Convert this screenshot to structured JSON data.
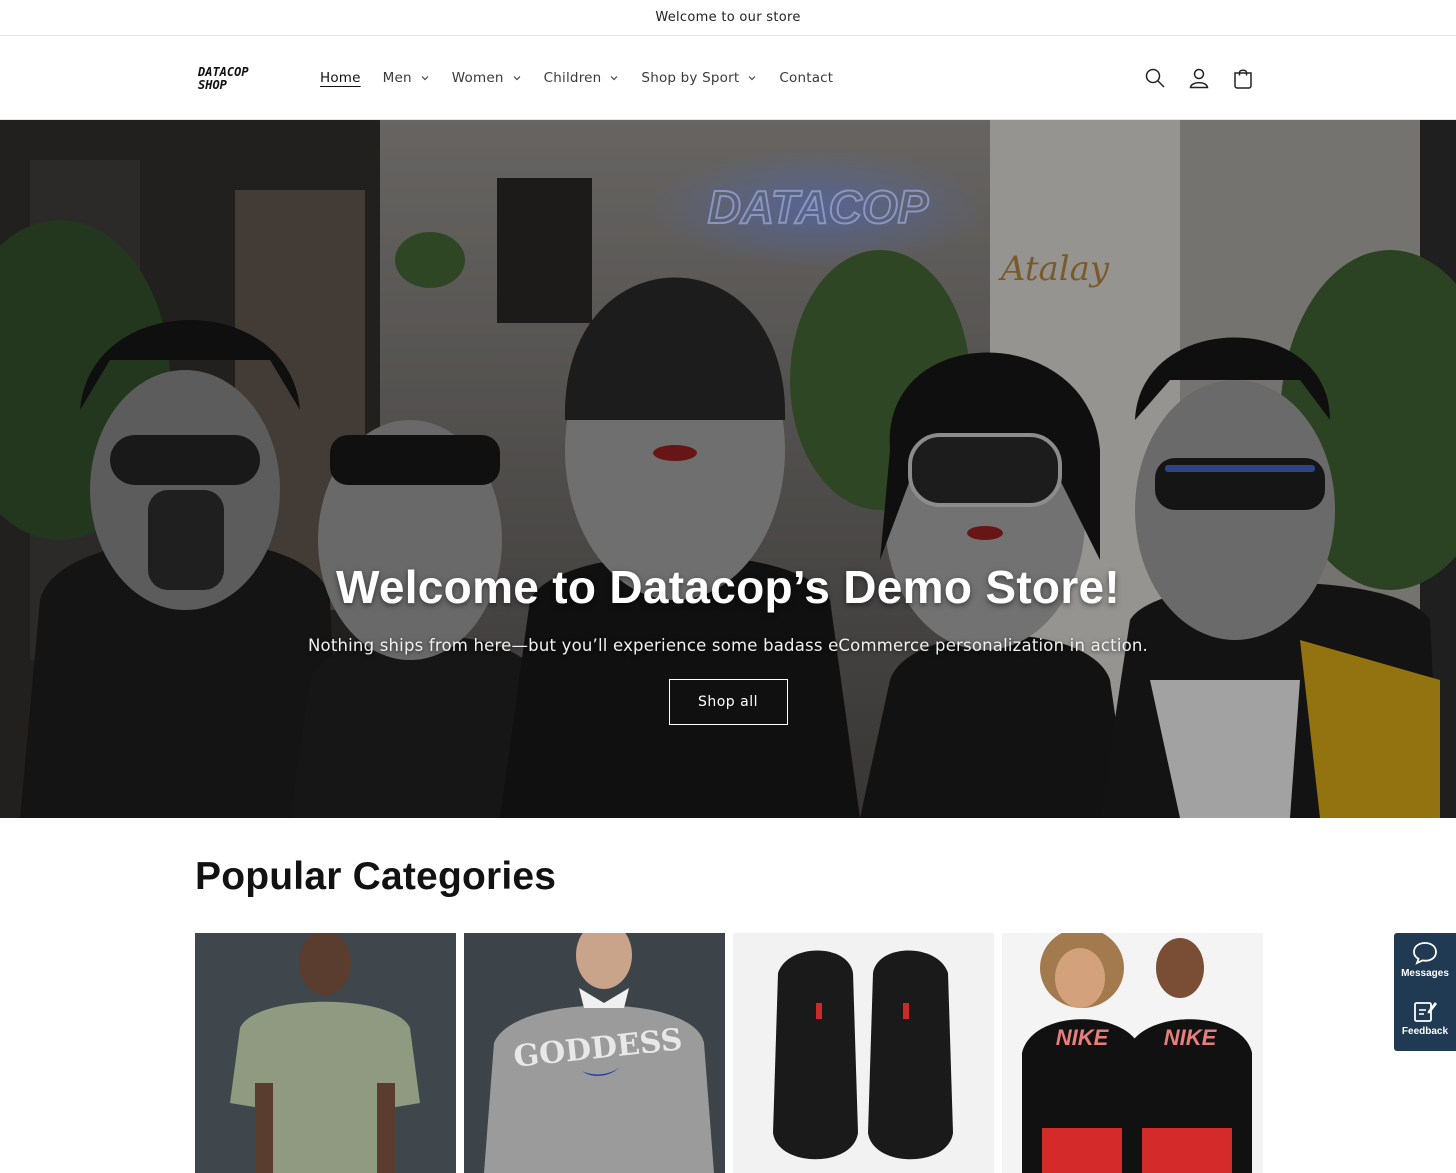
{
  "announcement": {
    "text": "Welcome to our store"
  },
  "header": {
    "logo_line1": "DATACOP",
    "logo_line2": "SHOP",
    "nav": [
      {
        "label": "Home",
        "active": true,
        "has_dropdown": false
      },
      {
        "label": "Men",
        "active": false,
        "has_dropdown": true
      },
      {
        "label": "Women",
        "active": false,
        "has_dropdown": true
      },
      {
        "label": "Children",
        "active": false,
        "has_dropdown": true
      },
      {
        "label": "Shop by Sport",
        "active": false,
        "has_dropdown": true
      },
      {
        "label": "Contact",
        "active": false,
        "has_dropdown": false
      }
    ],
    "icons": [
      "search-icon",
      "account-icon",
      "cart-icon"
    ]
  },
  "hero": {
    "title": "Welcome to Datacop’s Demo Store!",
    "subtitle": "Nothing ships from here—but you’ll experience some badass eCommerce personalization in action.",
    "button_label": "Shop all",
    "neon_sign": "DATACOP",
    "wall_script": "Atalay"
  },
  "categories": {
    "title": "Popular Categories",
    "items": [
      {
        "name": "men-tshirt",
        "bg": "#3f474c"
      },
      {
        "name": "women-sweatshirt",
        "bg": "#3d4449",
        "print": "GODDESS"
      },
      {
        "name": "black-sneakers",
        "bg": "#f2f2f2"
      },
      {
        "name": "kids-nike-tees",
        "bg": "#f4f4f4",
        "print": "NIKE"
      }
    ]
  },
  "widget": {
    "messages_label": "Messages",
    "feedback_label": "Feedback"
  },
  "colors": {
    "widget_bg": "#1f3a52",
    "neon_blue": "#6b8cff"
  }
}
